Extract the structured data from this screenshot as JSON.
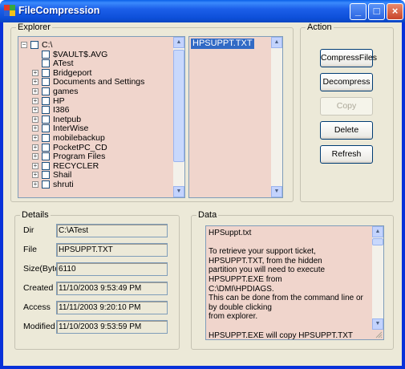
{
  "window": {
    "title": "FileCompression",
    "controls": [
      "_",
      "□",
      "×"
    ]
  },
  "explorer": {
    "label": "Explorer",
    "tree": [
      {
        "text": "C:\\",
        "level": 0,
        "expander": "minus"
      },
      {
        "text": "$VAULT$.AVG",
        "level": 1,
        "expander": ""
      },
      {
        "text": "ATest",
        "level": 1,
        "expander": ""
      },
      {
        "text": "Bridgeport",
        "level": 1,
        "expander": "plus"
      },
      {
        "text": "Documents and Settings",
        "level": 1,
        "expander": "plus"
      },
      {
        "text": "games",
        "level": 1,
        "expander": "plus"
      },
      {
        "text": "HP",
        "level": 1,
        "expander": "plus"
      },
      {
        "text": "I386",
        "level": 1,
        "expander": "plus"
      },
      {
        "text": "Inetpub",
        "level": 1,
        "expander": "plus"
      },
      {
        "text": "InterWise",
        "level": 1,
        "expander": "plus"
      },
      {
        "text": "mobilebackup",
        "level": 1,
        "expander": "plus"
      },
      {
        "text": "PocketPC_CD",
        "level": 1,
        "expander": "plus"
      },
      {
        "text": "Program Files",
        "level": 1,
        "expander": "plus"
      },
      {
        "text": "RECYCLER",
        "level": 1,
        "expander": "plus"
      },
      {
        "text": "Shail",
        "level": 1,
        "expander": "plus"
      },
      {
        "text": "shruti",
        "level": 1,
        "expander": "plus"
      }
    ],
    "files": [
      "HPSUPPT.TXT"
    ]
  },
  "action": {
    "label": "Action",
    "buttons": [
      {
        "label": "CompressFiles",
        "enabled": true
      },
      {
        "label": "Decompress",
        "enabled": true
      },
      {
        "label": "Copy",
        "enabled": false
      },
      {
        "label": "Delete",
        "enabled": true
      },
      {
        "label": "Refresh",
        "enabled": true
      }
    ]
  },
  "details": {
    "label": "Details",
    "fields": [
      {
        "label": "Dir",
        "value": "C:\\ATest"
      },
      {
        "label": "File",
        "value": "HPSUPPT.TXT"
      },
      {
        "label": "Size(Byte)",
        "value": "6110"
      },
      {
        "label": "Created",
        "value": "11/10/2003 9:53:49 PM"
      },
      {
        "label": "Access",
        "value": "11/11/2003 9:20:10 PM"
      },
      {
        "label": "Modified",
        "value": "11/10/2003 9:53:59 PM"
      }
    ]
  },
  "data_panel": {
    "label": "Data",
    "content": "HPSuppt.txt\n\nTo retrieve your support ticket, HPSUPPT.TXT, from the hidden\npartition you will need to execute HPSUPPT.EXE from\nC:\\DMI\\HPDIAGS.\nThis can be done from the command line or by double clicking\nfrom explorer.\n\nHPSUPPT.EXE will copy HPSUPPT.TXT from the diagnostics partition\nto the C:\\DMI\\HPDIAGS directory.  You can view or print the support"
  },
  "colors": {
    "titlebar": "#0a4fd9",
    "panel": "#ece9d8",
    "list_bg": "#f0d5cc",
    "selection": "#316ac5"
  }
}
